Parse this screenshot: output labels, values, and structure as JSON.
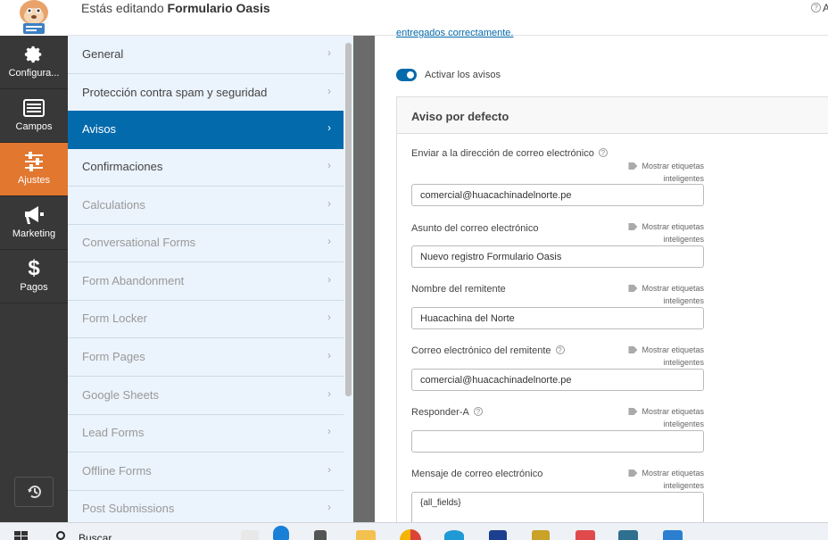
{
  "header": {
    "editing_prefix": "Estás editando",
    "form_name": "Formulario Oasis",
    "right_text": "A"
  },
  "sidebar": {
    "items": [
      {
        "label": "Configura...",
        "icon": "gear-icon"
      },
      {
        "label": "Campos",
        "icon": "fields-icon"
      },
      {
        "label": "Ajustes",
        "icon": "sliders-icon",
        "active": true
      },
      {
        "label": "Marketing",
        "icon": "megaphone-icon"
      },
      {
        "label": "Pagos",
        "icon": "dollar-icon"
      }
    ],
    "undo_icon": "history-icon"
  },
  "sections": [
    {
      "label": "General"
    },
    {
      "label": "Protección contra spam y seguridad"
    },
    {
      "label": "Avisos",
      "active": true
    },
    {
      "label": "Confirmaciones"
    },
    {
      "label": "Calculations"
    },
    {
      "label": "Conversational Forms"
    },
    {
      "label": "Form Abandonment"
    },
    {
      "label": "Form Locker"
    },
    {
      "label": "Form Pages"
    },
    {
      "label": "Google Sheets"
    },
    {
      "label": "Lead Forms"
    },
    {
      "label": "Offline Forms"
    },
    {
      "label": "Post Submissions"
    }
  ],
  "main": {
    "cut_link": "entregados correctamente.",
    "toggle_label": "Activar los avisos",
    "toggle_on": true,
    "panel_title": "Aviso por defecto",
    "smart_tags_line1": "Mostrar etiquetas",
    "smart_tags_line2": "inteligentes",
    "fields": [
      {
        "label": "Enviar a la dirección de correo electrónico",
        "help": true,
        "value": "comercial@huacachinadelnorte.pe"
      },
      {
        "label": "Asunto del correo electrónico",
        "help": false,
        "value": "Nuevo registro Formulario Oasis"
      },
      {
        "label": "Nombre del remitente",
        "help": false,
        "value": "Huacachina del Norte"
      },
      {
        "label": "Correo electrónico del remitente",
        "help": true,
        "value": "comercial@huacachinadelnorte.pe"
      },
      {
        "label": "Responder-A",
        "help": true,
        "value": ""
      },
      {
        "label": "Mensaje de correo electrónico",
        "help": false,
        "value": "{all_fields}"
      }
    ]
  },
  "taskbar": {
    "search_text": "Buscar"
  },
  "colors": {
    "accent_blue": "#036aab",
    "sidebar_dark": "#383838",
    "sidebar_active": "#e27730",
    "section_bg": "#ebf3fc"
  }
}
